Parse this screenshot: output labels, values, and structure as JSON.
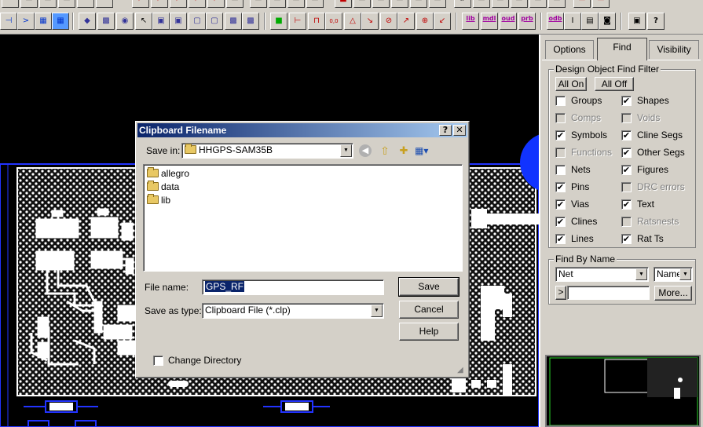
{
  "dialog": {
    "title": "Clipboard Filename",
    "help_glyph": "?",
    "close_glyph": "✕",
    "save_in_label": "Save in:",
    "save_in_value": "HHGPS-SAM35B",
    "files": [
      {
        "name": "allegro"
      },
      {
        "name": "data"
      },
      {
        "name": "lib"
      }
    ],
    "file_name_label": "File name:",
    "file_name_value": "GPS_RF",
    "save_as_type_label": "Save as type:",
    "save_as_type_value": "Clipboard File (*.clp)",
    "save_button": "Save",
    "cancel_button": "Cancel",
    "help_button": "Help",
    "change_directory_label": "Change Directory",
    "change_directory_checked": false
  },
  "panel": {
    "tabs": [
      {
        "label": "Options",
        "active": false
      },
      {
        "label": "Find",
        "active": true
      },
      {
        "label": "Visibility",
        "active": false
      }
    ],
    "filter_group_title": "Design Object Find Filter",
    "all_on": "All On",
    "all_off": "All Off",
    "filters_left": [
      {
        "label": "Groups",
        "checked": false,
        "enabled": true
      },
      {
        "label": "Comps",
        "checked": false,
        "enabled": false
      },
      {
        "label": "Symbols",
        "checked": true,
        "enabled": true
      },
      {
        "label": "Functions",
        "checked": false,
        "enabled": false
      },
      {
        "label": "Nets",
        "checked": false,
        "enabled": true
      },
      {
        "label": "Pins",
        "checked": true,
        "enabled": true
      },
      {
        "label": "Vias",
        "checked": true,
        "enabled": true
      },
      {
        "label": "Clines",
        "checked": true,
        "enabled": true
      },
      {
        "label": "Lines",
        "checked": true,
        "enabled": true
      }
    ],
    "filters_right": [
      {
        "label": "Shapes",
        "checked": true,
        "enabled": true
      },
      {
        "label": "Voids",
        "checked": false,
        "enabled": false
      },
      {
        "label": "Cline Segs",
        "checked": true,
        "enabled": true
      },
      {
        "label": "Other Segs",
        "checked": true,
        "enabled": true
      },
      {
        "label": "Figures",
        "checked": true,
        "enabled": true
      },
      {
        "label": "DRC errors",
        "checked": false,
        "enabled": false
      },
      {
        "label": "Text",
        "checked": true,
        "enabled": true
      },
      {
        "label": "Ratsnests",
        "checked": false,
        "enabled": false
      },
      {
        "label": "Rat Ts",
        "checked": true,
        "enabled": true
      }
    ],
    "find_by_name_title": "Find By Name",
    "find_type": "Net",
    "find_mode": "Name",
    "find_prompt": ">",
    "find_value": "",
    "more_button": "More..."
  },
  "toolbar": {
    "text_buttons": [
      "lib",
      "mdl",
      "oud",
      "prb",
      "odb"
    ],
    "help_glyph": "?"
  },
  "colors": {
    "canvas_bg": "#000000",
    "board_fill": "#1a1a1a",
    "copper": "#ffffff",
    "outline_blue": "#2233ff",
    "title_bar": "#0a246a"
  }
}
